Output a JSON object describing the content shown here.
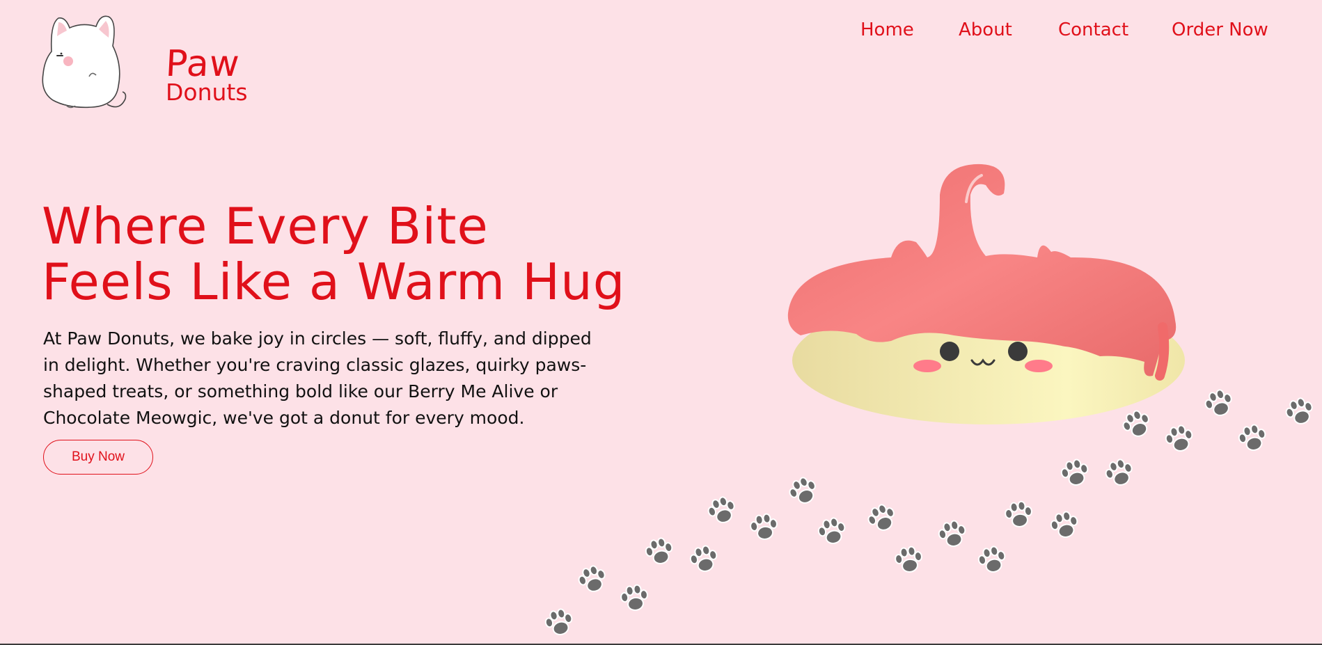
{
  "brand": {
    "name_line1": "Paw",
    "name_line2": "Donuts",
    "color": "#e0101a"
  },
  "nav": {
    "items": [
      {
        "label": "Home"
      },
      {
        "label": "About"
      },
      {
        "label": "Contact"
      },
      {
        "label": "Order Now"
      }
    ]
  },
  "hero": {
    "title_line1": "Where Every Bite",
    "title_line2": "Feels Like a Warm Hug",
    "description": "At Paw Donuts, we bake joy in circles — soft, fluffy, and dipped in delight. Whether you're craving classic glazes, quirky paws-shaped treats, or something bold like our Berry Me Alive or Chocolate Meowgic, we've got a donut for every mood.",
    "cta_label": "Buy Now"
  },
  "colors": {
    "background": "#fde1e7",
    "accent": "#e0101a",
    "glaze": "#f47c7c",
    "dough": "#f3e9a6",
    "paw": "#6b6b6b"
  },
  "icons": {
    "logo": "white-cat-mascot-icon",
    "hero_image": "cat-donut-illustration",
    "decoration": "paw-print-icon"
  }
}
